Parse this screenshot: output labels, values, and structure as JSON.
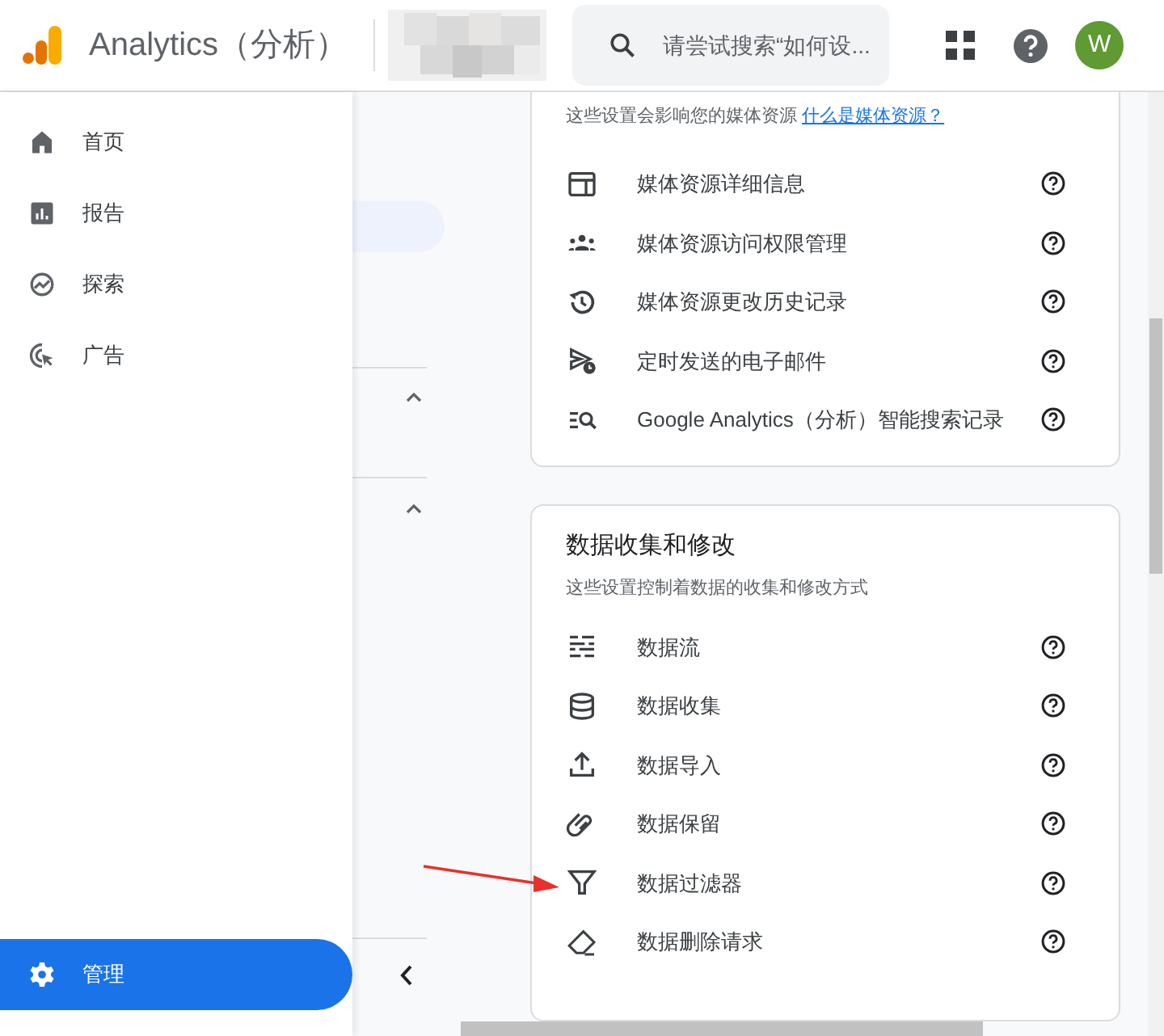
{
  "header": {
    "app_name": "Analytics（分析）",
    "search": {
      "placeholder": "请尝试搜索“如何设..."
    },
    "avatar": "W"
  },
  "nav": [
    {
      "label": "首页",
      "selected": false
    },
    {
      "label": "报告",
      "selected": false
    },
    {
      "label": "探索",
      "selected": false
    },
    {
      "label": "广告",
      "selected": false
    },
    {
      "label": "管理",
      "selected": true
    }
  ],
  "property_card": {
    "subtitle": "这些设置会影响您的媒体资源",
    "link": "什么是媒体资源？",
    "items": [
      {
        "label": "媒体资源详细信息"
      },
      {
        "label": "媒体资源访问权限管理"
      },
      {
        "label": "媒体资源更改历史记录"
      },
      {
        "label": "定时发送的电子邮件"
      },
      {
        "label": "Google Analytics（分析）智能搜索记录"
      }
    ]
  },
  "data_card": {
    "title": "数据收集和修改",
    "subtitle": "这些设置控制着数据的收集和修改方式",
    "items": [
      {
        "label": "数据流"
      },
      {
        "label": "数据收集"
      },
      {
        "label": "数据导入"
      },
      {
        "label": "数据保留"
      },
      {
        "label": "数据过滤器"
      },
      {
        "label": "数据删除请求"
      }
    ]
  }
}
